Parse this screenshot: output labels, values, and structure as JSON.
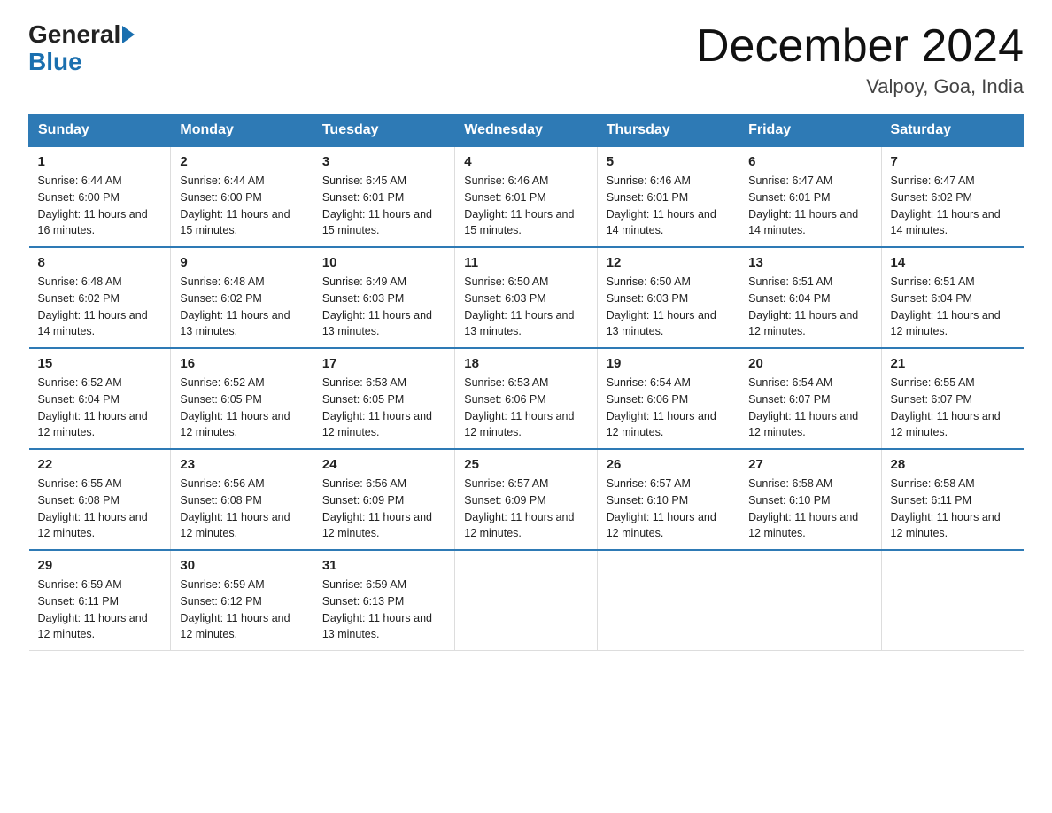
{
  "header": {
    "logo_general": "General",
    "logo_blue": "Blue",
    "month_title": "December 2024",
    "location": "Valpoy, Goa, India"
  },
  "days_of_week": [
    "Sunday",
    "Monday",
    "Tuesday",
    "Wednesday",
    "Thursday",
    "Friday",
    "Saturday"
  ],
  "weeks": [
    [
      {
        "num": "1",
        "sunrise": "6:44 AM",
        "sunset": "6:00 PM",
        "daylight": "11 hours and 16 minutes."
      },
      {
        "num": "2",
        "sunrise": "6:44 AM",
        "sunset": "6:00 PM",
        "daylight": "11 hours and 15 minutes."
      },
      {
        "num": "3",
        "sunrise": "6:45 AM",
        "sunset": "6:01 PM",
        "daylight": "11 hours and 15 minutes."
      },
      {
        "num": "4",
        "sunrise": "6:46 AM",
        "sunset": "6:01 PM",
        "daylight": "11 hours and 15 minutes."
      },
      {
        "num": "5",
        "sunrise": "6:46 AM",
        "sunset": "6:01 PM",
        "daylight": "11 hours and 14 minutes."
      },
      {
        "num": "6",
        "sunrise": "6:47 AM",
        "sunset": "6:01 PM",
        "daylight": "11 hours and 14 minutes."
      },
      {
        "num": "7",
        "sunrise": "6:47 AM",
        "sunset": "6:02 PM",
        "daylight": "11 hours and 14 minutes."
      }
    ],
    [
      {
        "num": "8",
        "sunrise": "6:48 AM",
        "sunset": "6:02 PM",
        "daylight": "11 hours and 14 minutes."
      },
      {
        "num": "9",
        "sunrise": "6:48 AM",
        "sunset": "6:02 PM",
        "daylight": "11 hours and 13 minutes."
      },
      {
        "num": "10",
        "sunrise": "6:49 AM",
        "sunset": "6:03 PM",
        "daylight": "11 hours and 13 minutes."
      },
      {
        "num": "11",
        "sunrise": "6:50 AM",
        "sunset": "6:03 PM",
        "daylight": "11 hours and 13 minutes."
      },
      {
        "num": "12",
        "sunrise": "6:50 AM",
        "sunset": "6:03 PM",
        "daylight": "11 hours and 13 minutes."
      },
      {
        "num": "13",
        "sunrise": "6:51 AM",
        "sunset": "6:04 PM",
        "daylight": "11 hours and 12 minutes."
      },
      {
        "num": "14",
        "sunrise": "6:51 AM",
        "sunset": "6:04 PM",
        "daylight": "11 hours and 12 minutes."
      }
    ],
    [
      {
        "num": "15",
        "sunrise": "6:52 AM",
        "sunset": "6:04 PM",
        "daylight": "11 hours and 12 minutes."
      },
      {
        "num": "16",
        "sunrise": "6:52 AM",
        "sunset": "6:05 PM",
        "daylight": "11 hours and 12 minutes."
      },
      {
        "num": "17",
        "sunrise": "6:53 AM",
        "sunset": "6:05 PM",
        "daylight": "11 hours and 12 minutes."
      },
      {
        "num": "18",
        "sunrise": "6:53 AM",
        "sunset": "6:06 PM",
        "daylight": "11 hours and 12 minutes."
      },
      {
        "num": "19",
        "sunrise": "6:54 AM",
        "sunset": "6:06 PM",
        "daylight": "11 hours and 12 minutes."
      },
      {
        "num": "20",
        "sunrise": "6:54 AM",
        "sunset": "6:07 PM",
        "daylight": "11 hours and 12 minutes."
      },
      {
        "num": "21",
        "sunrise": "6:55 AM",
        "sunset": "6:07 PM",
        "daylight": "11 hours and 12 minutes."
      }
    ],
    [
      {
        "num": "22",
        "sunrise": "6:55 AM",
        "sunset": "6:08 PM",
        "daylight": "11 hours and 12 minutes."
      },
      {
        "num": "23",
        "sunrise": "6:56 AM",
        "sunset": "6:08 PM",
        "daylight": "11 hours and 12 minutes."
      },
      {
        "num": "24",
        "sunrise": "6:56 AM",
        "sunset": "6:09 PM",
        "daylight": "11 hours and 12 minutes."
      },
      {
        "num": "25",
        "sunrise": "6:57 AM",
        "sunset": "6:09 PM",
        "daylight": "11 hours and 12 minutes."
      },
      {
        "num": "26",
        "sunrise": "6:57 AM",
        "sunset": "6:10 PM",
        "daylight": "11 hours and 12 minutes."
      },
      {
        "num": "27",
        "sunrise": "6:58 AM",
        "sunset": "6:10 PM",
        "daylight": "11 hours and 12 minutes."
      },
      {
        "num": "28",
        "sunrise": "6:58 AM",
        "sunset": "6:11 PM",
        "daylight": "11 hours and 12 minutes."
      }
    ],
    [
      {
        "num": "29",
        "sunrise": "6:59 AM",
        "sunset": "6:11 PM",
        "daylight": "11 hours and 12 minutes."
      },
      {
        "num": "30",
        "sunrise": "6:59 AM",
        "sunset": "6:12 PM",
        "daylight": "11 hours and 12 minutes."
      },
      {
        "num": "31",
        "sunrise": "6:59 AM",
        "sunset": "6:13 PM",
        "daylight": "11 hours and 13 minutes."
      },
      null,
      null,
      null,
      null
    ]
  ]
}
